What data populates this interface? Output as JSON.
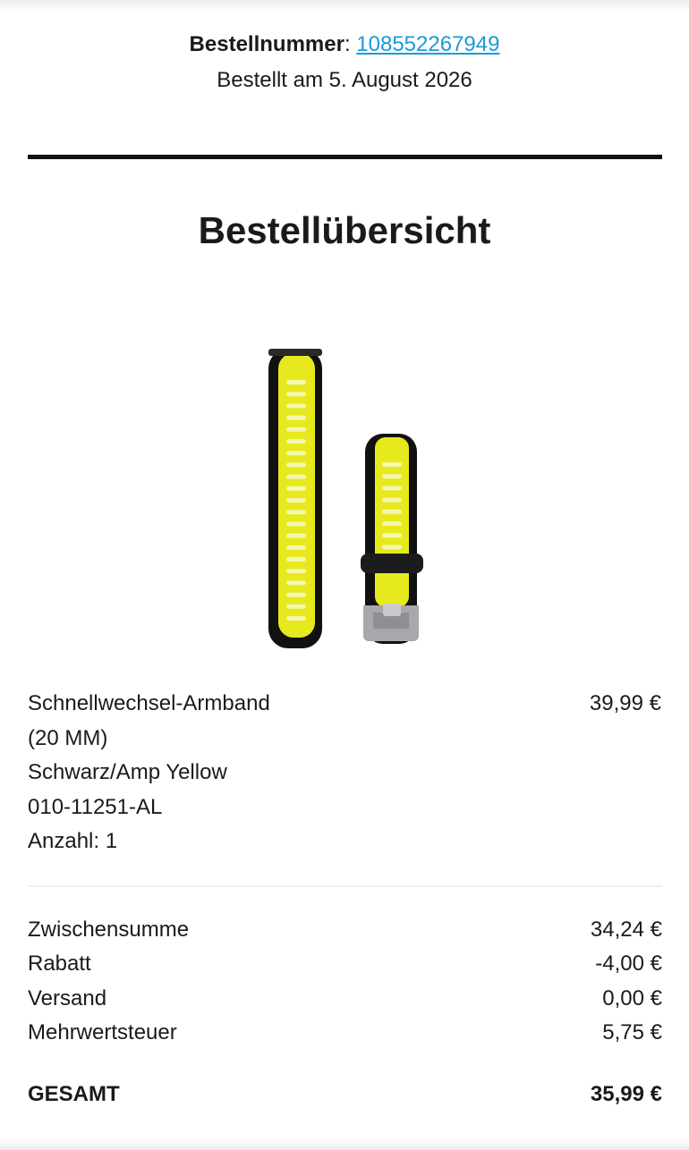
{
  "order": {
    "number_label": "Bestellnummer",
    "number": "108552267949",
    "date_text": "Bestellt am 5. August 2026"
  },
  "summary": {
    "title": "Bestellübersicht"
  },
  "product": {
    "name_line1": "Schnellwechsel-Armband",
    "name_line2": "(20 MM)",
    "color": "Schwarz/Amp Yellow",
    "sku": "010-11251-AL",
    "quantity": "Anzahl: 1",
    "price": "39,99 €",
    "image": {
      "icon": "watch-band-image",
      "colors": {
        "band": "#111111",
        "accent": "#e6ea1c",
        "buckle": "#a6a8ab"
      }
    }
  },
  "totals": [
    {
      "label": "Zwischensumme",
      "value": "34,24 €"
    },
    {
      "label": "Rabatt",
      "value": "-4,00 €"
    },
    {
      "label": "Versand",
      "value": "0,00 €"
    },
    {
      "label": "Mehrwertsteuer",
      "value": "5,75 €"
    }
  ],
  "grand_total": {
    "label": "GESAMT",
    "value": "35,99 €"
  },
  "colors": {
    "link": "#1b9ad6",
    "text": "#1a1a1a",
    "rule": "#111111",
    "divider": "#eeeeee"
  }
}
